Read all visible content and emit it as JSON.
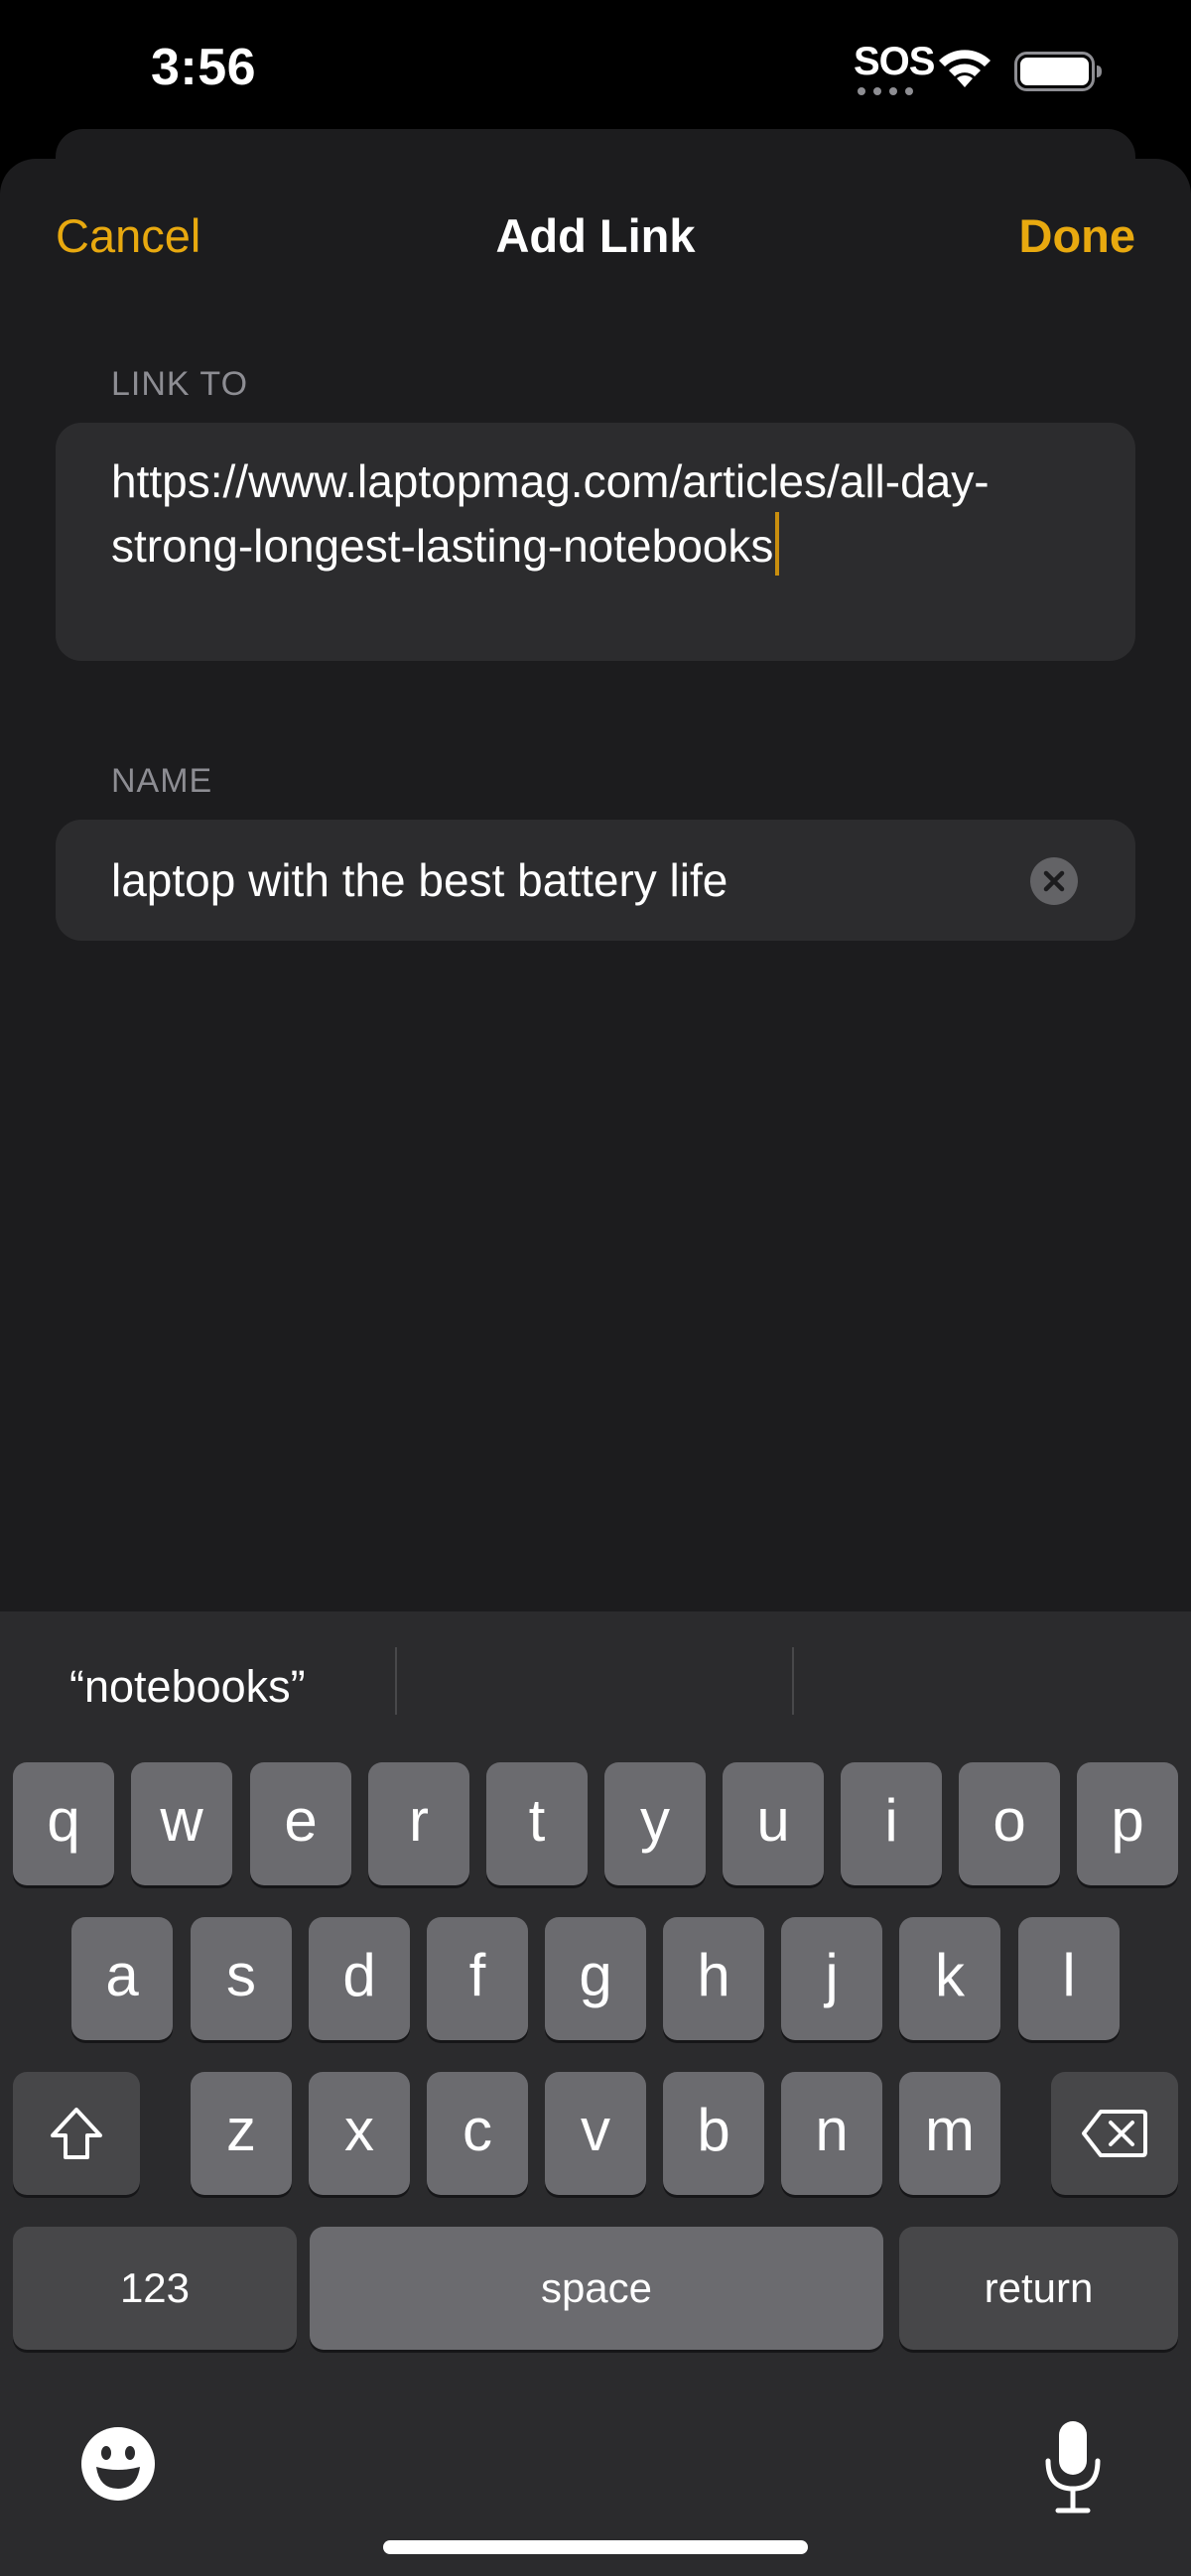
{
  "status_bar": {
    "time": "3:56",
    "sos": "SOS",
    "icons": [
      "wifi-icon",
      "battery-icon"
    ]
  },
  "nav": {
    "cancel_label": "Cancel",
    "title": "Add Link",
    "done_label": "Done"
  },
  "link_section": {
    "label": "LINK TO",
    "value_line1": "https://www.laptopmag.com/articles/all-day-",
    "value_line2": "strong-longest-lasting-notebooks"
  },
  "name_section": {
    "label": "NAME",
    "value": "laptop with the best battery life",
    "clear_icon": "clear-icon"
  },
  "keyboard": {
    "suggestions": [
      "“notebooks”",
      "",
      ""
    ],
    "row1": [
      "q",
      "w",
      "e",
      "r",
      "t",
      "y",
      "u",
      "i",
      "o",
      "p"
    ],
    "row2": [
      "a",
      "s",
      "d",
      "f",
      "g",
      "h",
      "j",
      "k",
      "l"
    ],
    "row3": [
      "z",
      "x",
      "c",
      "v",
      "b",
      "n",
      "m"
    ],
    "numbers_label": "123",
    "space_label": "space",
    "return_label": "return",
    "icons": [
      "shift-icon",
      "delete-icon",
      "emoji-icon",
      "microphone-icon"
    ]
  },
  "colors": {
    "accent": "#e8a90f",
    "background": "#1c1c1e",
    "field": "#2c2c2e",
    "keyboard": "#2b2b2d"
  }
}
